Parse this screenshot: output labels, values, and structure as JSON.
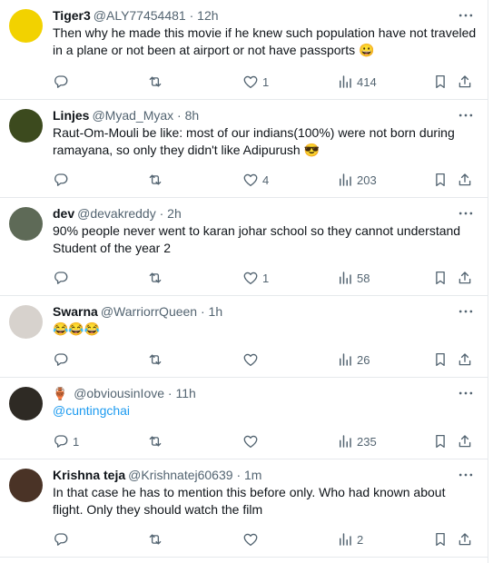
{
  "tweets": [
    {
      "name": "Tiger3",
      "handle": "@ALY77454481",
      "time": "12h",
      "lines": [
        "Then why he made this movie if he knew such population have not traveled",
        "in a plane or not been at airport or not have passports 😀"
      ],
      "replies": "",
      "retweets": "",
      "likes": "1",
      "views": "414",
      "avatar_color": "#f2d200"
    },
    {
      "name": "Linjes",
      "handle": "@Myad_Myax",
      "time": "8h",
      "lines": [
        "Raut-Om-Mouli  be like: most of our indians(100%) were not born during",
        "ramayana, so only they didn't like Adipurush 😎"
      ],
      "replies": "",
      "retweets": "",
      "likes": "4",
      "views": "203",
      "avatar_color": "#3c4a1e"
    },
    {
      "name": "dev",
      "handle": "@devakreddy",
      "time": "2h",
      "lines": [
        "90% people never went to karan johar school so they cannot understand",
        "Student of the year 2"
      ],
      "replies": "",
      "retweets": "",
      "likes": "1",
      "views": "58",
      "avatar_color": "#5e6a57"
    },
    {
      "name": "Swarna",
      "handle": "@WarriorrQueen",
      "time": "1h",
      "lines": [
        "😂😂😂"
      ],
      "replies": "",
      "retweets": "",
      "likes": "",
      "views": "26",
      "avatar_color": "#d7d2cd"
    },
    {
      "name_emoji": "🏺",
      "name": "",
      "handle": "@obviousinIove",
      "time": "11h",
      "lines": [],
      "mention": "@cuntingchai",
      "replies": "1",
      "retweets": "",
      "likes": "",
      "views": "235",
      "avatar_color": "#2e2a24"
    },
    {
      "name": "Krishna teja",
      "handle": "@Krishnatej60639",
      "time": "1m",
      "lines": [
        "In that case he has to mention this  before only. Who had known about",
        "flight. Only they should watch the film"
      ],
      "replies": "",
      "retweets": "",
      "likes": "",
      "views": "2",
      "avatar_color": "#4a3326"
    }
  ],
  "separator": "·",
  "icons": {
    "more": "more-horizontal-icon",
    "reply": "reply-icon",
    "retweet": "retweet-icon",
    "like": "like-heart-icon",
    "views": "views-chart-icon",
    "bookmark": "bookmark-icon",
    "share": "share-icon"
  },
  "colors": {
    "text": "#0f1419",
    "secondary": "#536471",
    "link": "#1d9bf0",
    "divider": "#e6e9ec"
  }
}
